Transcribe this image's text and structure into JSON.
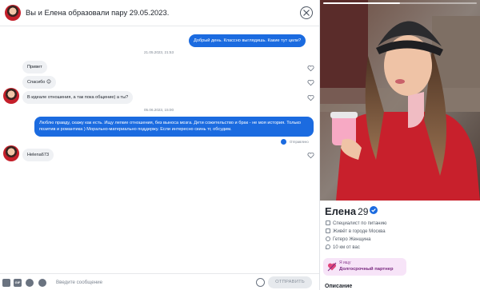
{
  "header": {
    "title": "Вы и Елена образовали пару 29.05.2023."
  },
  "messages": [
    {
      "kind": "stamp",
      "text": "21.05.2023, 21:53"
    },
    {
      "kind": "out",
      "text": "Добрый день. Классно выглядишь. Какие тут цели?"
    },
    {
      "kind": "in",
      "text": "Привет"
    },
    {
      "kind": "in",
      "text": "Спасибо 😊"
    },
    {
      "kind": "in",
      "text": "В идеале отношения, а так пока общение) а ты?"
    },
    {
      "kind": "stamp",
      "text": "05.06.2023, 15:00"
    },
    {
      "kind": "out",
      "text": "Люблю правду, скажу как есть. Ищу легкие отношения, без выноса мозга. Дети сожительство и брак - не моя история. Только позитив и романтика ) Морально-материально поддержу. Если интересно скинь тг, обсудим."
    },
    {
      "kind": "status",
      "text": "Отправлено"
    },
    {
      "kind": "in",
      "text": "Helena673"
    }
  ],
  "composer": {
    "placeholder": "Введите сообщение",
    "send_label": "ОТПРАВИТЬ",
    "gif_label": "GIF"
  },
  "profile": {
    "name": "Елена",
    "age": "29",
    "photo_progress": 0.5,
    "details": [
      {
        "icon": "briefcase-icon",
        "text": "Специалист по питанию"
      },
      {
        "icon": "home-icon",
        "text": "Живёт в городе Москва"
      },
      {
        "icon": "gender-icon",
        "text": "Гетеро Женщина"
      },
      {
        "icon": "location-pin-icon",
        "text": "10 км от вас"
      }
    ],
    "looking_for": {
      "label": "Я ищу",
      "value": "Долгосрочный партнер"
    },
    "section_title": "Описание"
  },
  "colors": {
    "accent": "#1b6be0",
    "incoming_bubble": "#eff1f4",
    "looking_bg": "#f7e4f8"
  }
}
